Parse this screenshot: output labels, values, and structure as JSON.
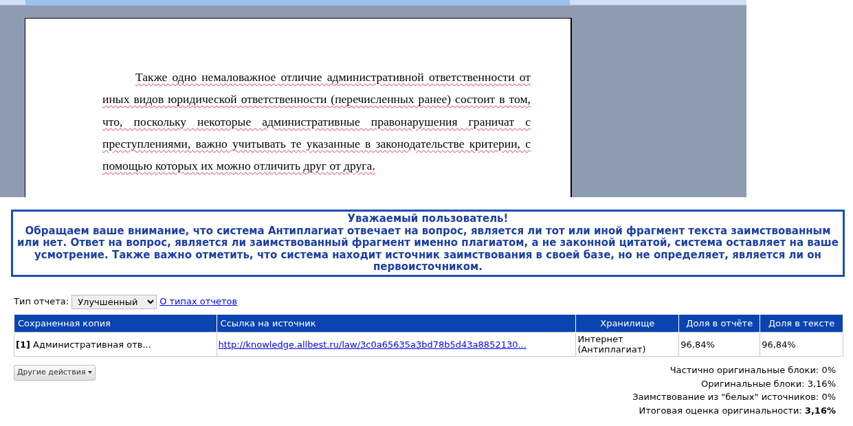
{
  "document": {
    "paragraph": "Также одно немаловажное отличие административной ответственности от иных видов юридической ответственности (перечисленных ранее) состоит в том, что, поскольку некоторые административные правонарушения граничат с преступлениями, важно учитывать те указанные в законодательстве критерии, с помощью которых их можно отличить друг от друга."
  },
  "notice": {
    "title": "Уважаемый пользователь!",
    "body": "Обращаем ваше внимание, что система Антиплагиат отвечает на вопрос, является ли тот или иной фрагмент текста заимствованным или нет. Ответ на вопрос, является ли заимствованный фрагмент именно плагиатом, а не законной цитатой, система оставляет на ваше усмотрение. Также важно отметить, что система находит источник заимствования в своей базе, но не определяет, является ли он первоисточником."
  },
  "report_type": {
    "label": "Тип отчета:",
    "value": "Улучшенный",
    "link": "О типах отчетов"
  },
  "table": {
    "columns": [
      "Сохраненная копия",
      "Ссылка на источник",
      "Хранилище",
      "Доля в отчёте",
      "Доля в тексте"
    ],
    "rows": [
      {
        "index": "[1]",
        "copy": "Административная отв...",
        "link": "http://knowledge.allbest.ru/law/3c0a65635a3bd78b5d43a8852130...",
        "storage": "Интернет (Антиплагиат)",
        "share_report": "96,84%",
        "share_text": "96,84%"
      }
    ]
  },
  "actions_button": "Другие действия",
  "stats": [
    {
      "label": "Частично оригинальные блоки:",
      "value": "0%",
      "bold": false
    },
    {
      "label": "Оригинальные блоки:",
      "value": "3,16%",
      "bold": false
    },
    {
      "label": "Заимствование из \"белых\" источников:",
      "value": "0%",
      "bold": false
    },
    {
      "label": "Итоговая оценка оригинальности:",
      "value": "3,16%",
      "bold": true
    }
  ]
}
